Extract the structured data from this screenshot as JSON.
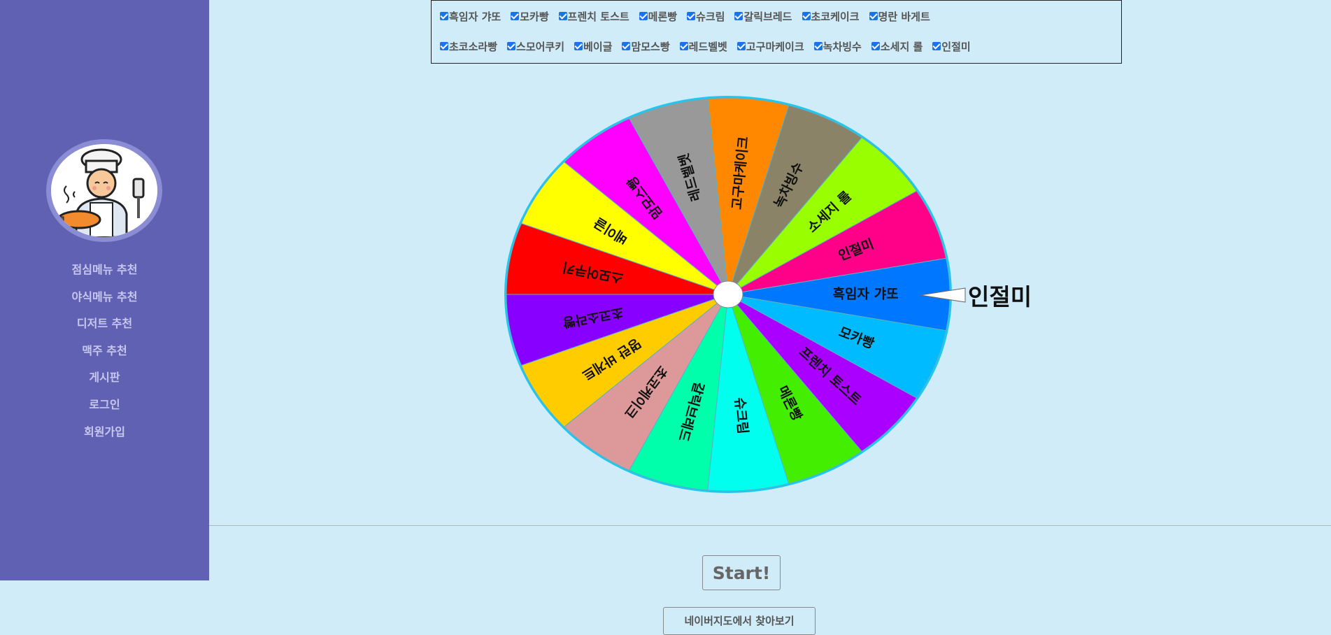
{
  "sidebar": {
    "avatar_icon": "chef-icon",
    "items": [
      {
        "label": "점심메뉴 추천"
      },
      {
        "label": "야식메뉴 추천"
      },
      {
        "label": "디저트 추천"
      },
      {
        "label": "맥주 추천"
      },
      {
        "label": "게시판"
      },
      {
        "label": "로그인"
      },
      {
        "label": "회원가입"
      }
    ]
  },
  "options": {
    "row1": [
      {
        "label": "흑임자 갸또",
        "checked": true
      },
      {
        "label": "모카빵",
        "checked": true
      },
      {
        "label": "프렌치 토스트",
        "checked": true
      },
      {
        "label": "메론빵",
        "checked": true
      },
      {
        "label": "슈크림",
        "checked": true
      },
      {
        "label": "갈릭브레드",
        "checked": true
      },
      {
        "label": "초코케이크",
        "checked": true
      },
      {
        "label": "명란 바게트",
        "checked": true
      }
    ],
    "row2": [
      {
        "label": "초코소라빵",
        "checked": true
      },
      {
        "label": "스모어쿠키",
        "checked": true
      },
      {
        "label": "베이글",
        "checked": true
      },
      {
        "label": "맘모스빵",
        "checked": true
      },
      {
        "label": "레드벨벳",
        "checked": true
      },
      {
        "label": "고구마케이크",
        "checked": true
      },
      {
        "label": "녹차빙수",
        "checked": true
      },
      {
        "label": "소세지 롤",
        "checked": true
      },
      {
        "label": "인절미",
        "checked": true
      }
    ]
  },
  "wheel": {
    "segments": [
      {
        "label": "인절미",
        "color": "#ff0088"
      },
      {
        "label": "소세지 롤",
        "color": "#99ff00"
      },
      {
        "label": "녹차빙수",
        "color": "#8b8368"
      },
      {
        "label": "고구마케이크",
        "color": "#ff8800"
      },
      {
        "label": "레드벨벳",
        "color": "#999999"
      },
      {
        "label": "맘모스빵",
        "color": "#ff00ff"
      },
      {
        "label": "베이글",
        "color": "#ffff00"
      },
      {
        "label": "스모어쿠키",
        "color": "#ff0000"
      },
      {
        "label": "초코소라빵",
        "color": "#8800ff"
      },
      {
        "label": "명란 바게트",
        "color": "#ffcc00"
      },
      {
        "label": "초코케이크",
        "color": "#dd9999"
      },
      {
        "label": "갈릭브레드",
        "color": "#00ffaa"
      },
      {
        "label": "슈크림",
        "color": "#00ffee"
      },
      {
        "label": "메론빵",
        "color": "#44ee00"
      },
      {
        "label": "프렌치 토스트",
        "color": "#aa00ff"
      },
      {
        "label": "모카빵",
        "color": "#00bbff"
      },
      {
        "label": "흑임자 갸또",
        "color": "#0077ff"
      }
    ],
    "rim_color": "#1ec8f0",
    "result": "인절미"
  },
  "start_label": "Start!",
  "map_label": "네이버지도에서 찾아보기"
}
